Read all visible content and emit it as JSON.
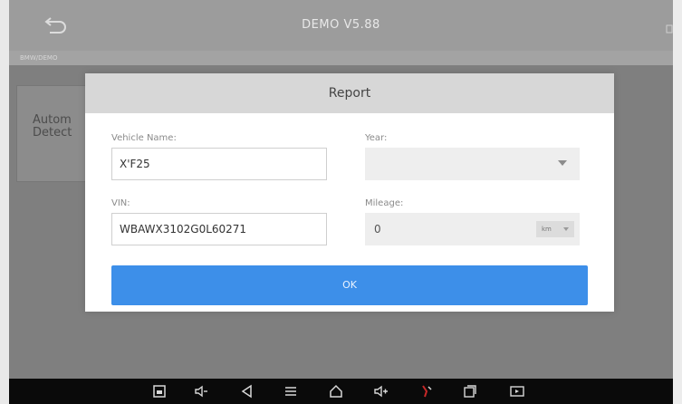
{
  "topbar": {
    "title": "DEMO V5.88",
    "back_icon": "back-arrow-icon"
  },
  "breadcrumb": {
    "text": "BMW/DEMO"
  },
  "background_card": {
    "label": "Autom\nDetect"
  },
  "dialog": {
    "title": "Report",
    "vehicle_name_label": "Vehicle Name:",
    "vehicle_name_value": "X'F25",
    "year_label": "Year:",
    "year_value": "",
    "vin_label": "VIN:",
    "vin_value": "WBAWX3102G0L60271",
    "mileage_label": "Mileage:",
    "mileage_value": "0",
    "mileage_unit": "km",
    "ok_label": "OK"
  },
  "colors": {
    "accent": "#3d8fe9",
    "overlay": "#7f7f7f",
    "navbar": "#0a0a0a"
  },
  "navbar_icons": [
    "screenshot-icon",
    "volume-down-icon",
    "back-icon",
    "menu-icon",
    "home-icon",
    "volume-up-icon",
    "vci-icon",
    "recent-apps-icon",
    "screen-record-icon"
  ]
}
